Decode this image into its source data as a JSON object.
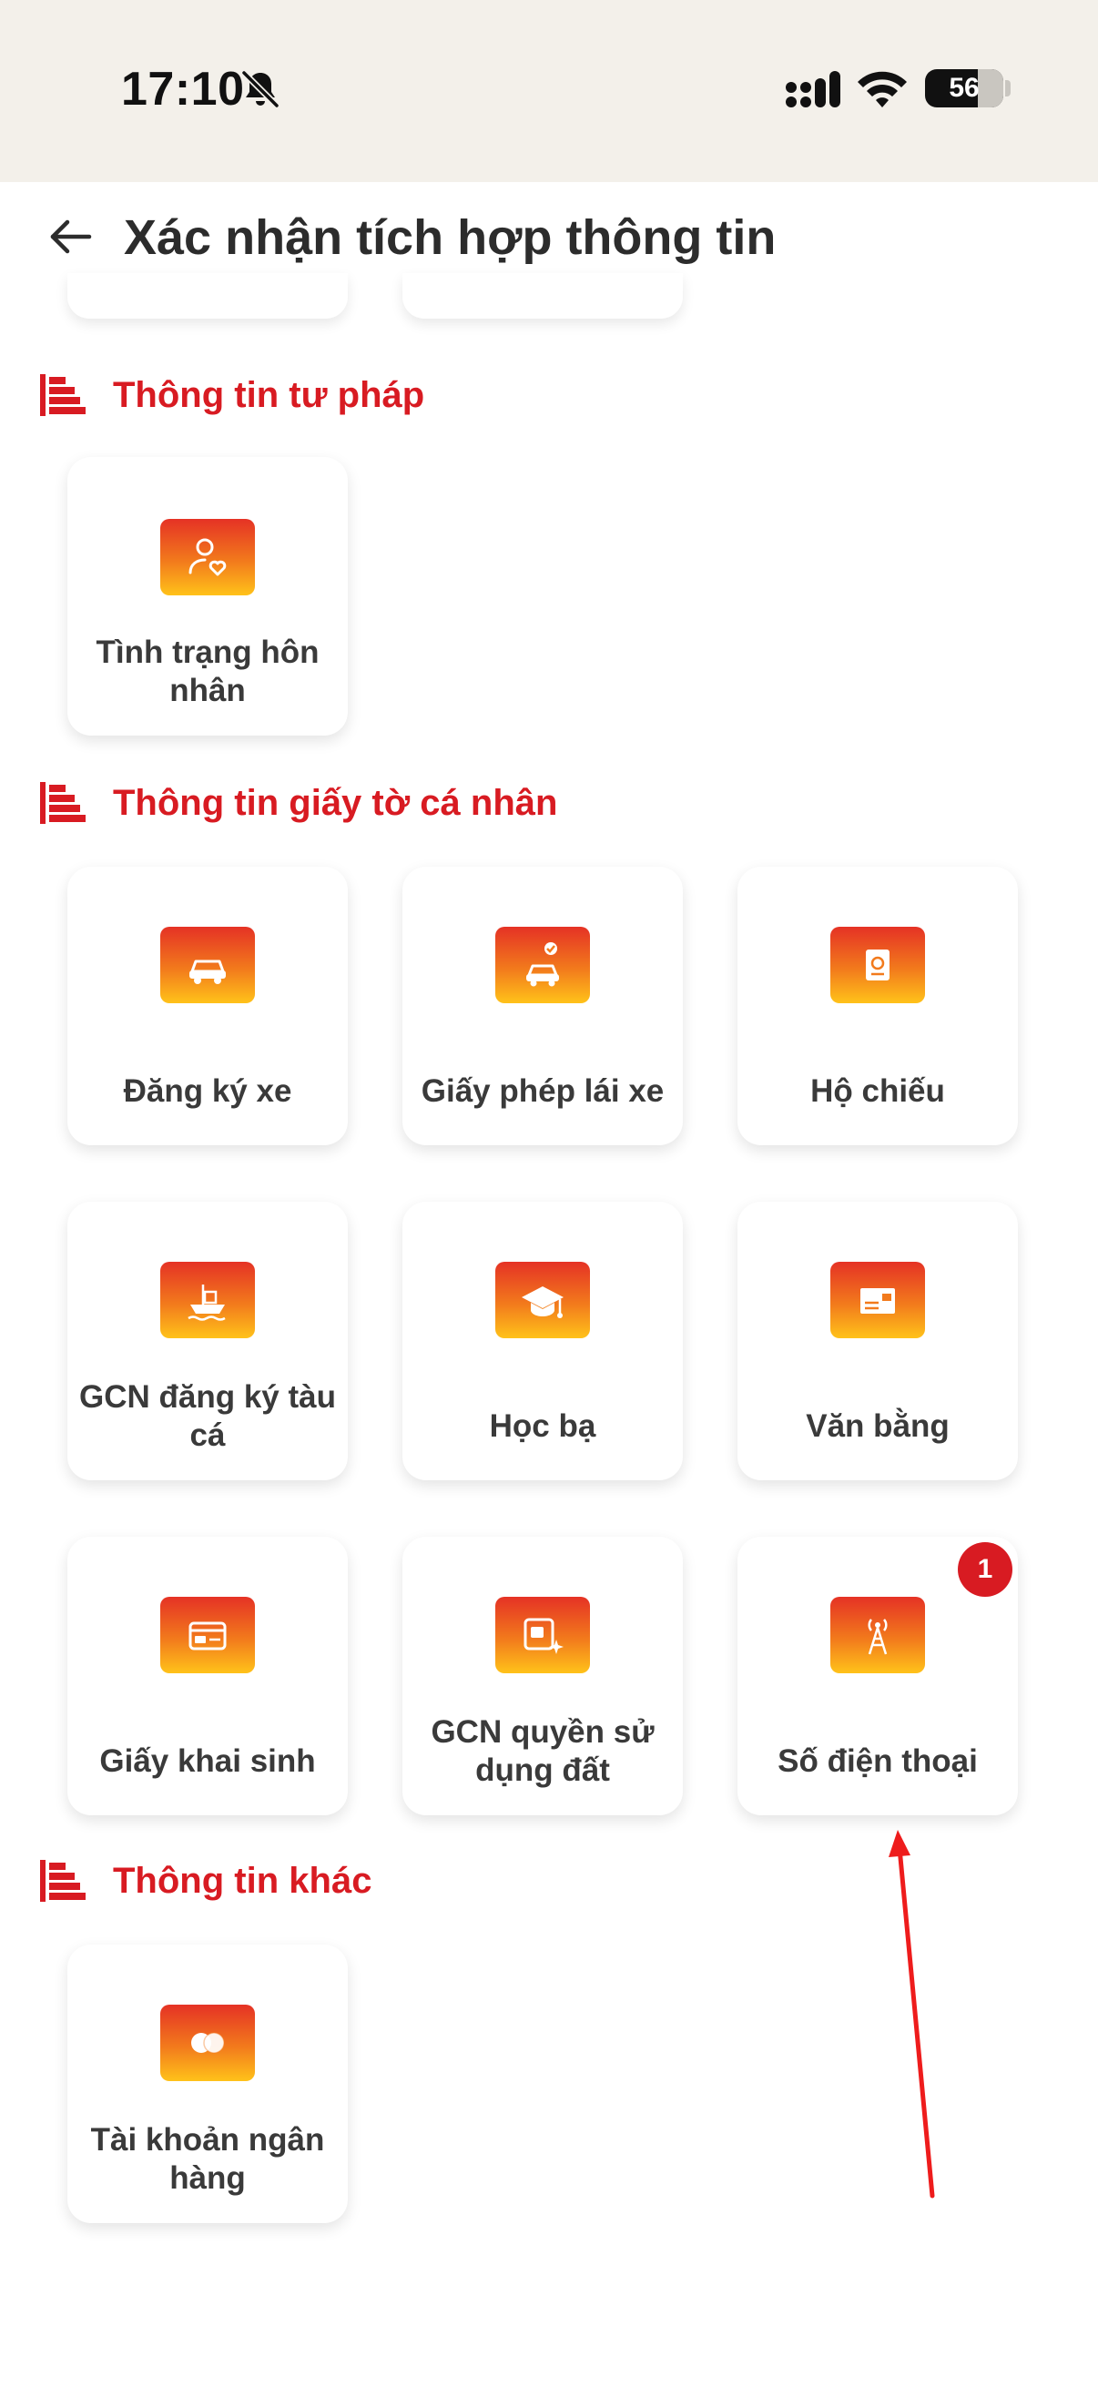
{
  "status_bar": {
    "time": "17:10",
    "battery": "56",
    "icons": [
      "bell-slash-icon",
      "signal-icon",
      "wifi-icon",
      "battery-icon"
    ]
  },
  "header": {
    "title": "Xác nhận tích hợp thông tin",
    "back_icon": "arrow-left-icon"
  },
  "sections": {
    "justice": {
      "title": "Thông tin tư pháp",
      "items": [
        {
          "label": "Tình trạng hôn nhân",
          "icon": "person-heart-icon"
        }
      ]
    },
    "personal_docs": {
      "title": "Thông tin giấy tờ cá nhân",
      "items": [
        {
          "label": "Đăng ký xe",
          "icon": "car-icon"
        },
        {
          "label": "Giấy phép lái xe",
          "icon": "driver-license-icon"
        },
        {
          "label": "Hộ chiếu",
          "icon": "passport-icon"
        },
        {
          "label": "GCN đăng ký tàu cá",
          "icon": "fishing-boat-icon"
        },
        {
          "label": "Học bạ",
          "icon": "graduation-cap-icon"
        },
        {
          "label": "Văn bằng",
          "icon": "diploma-icon"
        },
        {
          "label": "Giấy khai sinh",
          "icon": "birth-certificate-icon"
        },
        {
          "label": "GCN quyền sử dụng đất",
          "icon": "land-certificate-icon"
        },
        {
          "label": "Số điện thoại",
          "icon": "antenna-icon",
          "badge": "1"
        }
      ]
    },
    "other": {
      "title": "Thông tin khác",
      "items": [
        {
          "label": "Tài khoản ngân hàng",
          "icon": "bank-card-icon"
        }
      ]
    }
  },
  "colors": {
    "accent": "#d81b22",
    "header_bg": "#f3f0ea",
    "icon_gradient_top": "#e53225",
    "icon_gradient_bottom": "#ffc21a",
    "annotation_arrow": "#ee1c1c"
  }
}
